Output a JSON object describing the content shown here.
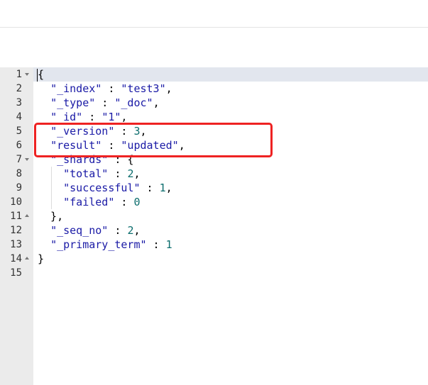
{
  "gutter": {
    "line_numbers": [
      "1",
      "2",
      "3",
      "4",
      "5",
      "6",
      "7",
      "8",
      "9",
      "10",
      "11",
      "12",
      "13",
      "14",
      "15"
    ]
  },
  "code": {
    "lines": [
      [
        {
          "t": "{",
          "c": "punc"
        }
      ],
      [
        {
          "t": "  ",
          "c": "punc"
        },
        {
          "t": "\"_index\"",
          "c": "key"
        },
        {
          "t": " : ",
          "c": "punc"
        },
        {
          "t": "\"test3\"",
          "c": "str"
        },
        {
          "t": ",",
          "c": "punc"
        }
      ],
      [
        {
          "t": "  ",
          "c": "punc"
        },
        {
          "t": "\"_type\"",
          "c": "key"
        },
        {
          "t": " : ",
          "c": "punc"
        },
        {
          "t": "\"_doc\"",
          "c": "str"
        },
        {
          "t": ",",
          "c": "punc"
        }
      ],
      [
        {
          "t": "  ",
          "c": "punc"
        },
        {
          "t": "\"_id\"",
          "c": "key"
        },
        {
          "t": " : ",
          "c": "punc"
        },
        {
          "t": "\"1\"",
          "c": "str"
        },
        {
          "t": ",",
          "c": "punc"
        }
      ],
      [
        {
          "t": "  ",
          "c": "punc"
        },
        {
          "t": "\"_version\"",
          "c": "key"
        },
        {
          "t": " : ",
          "c": "punc"
        },
        {
          "t": "3",
          "c": "num"
        },
        {
          "t": ",",
          "c": "punc"
        }
      ],
      [
        {
          "t": "  ",
          "c": "punc"
        },
        {
          "t": "\"result\"",
          "c": "key"
        },
        {
          "t": " : ",
          "c": "punc"
        },
        {
          "t": "\"updated\"",
          "c": "str"
        },
        {
          "t": ",",
          "c": "punc"
        }
      ],
      [
        {
          "t": "  ",
          "c": "punc"
        },
        {
          "t": "\"_shards\"",
          "c": "key"
        },
        {
          "t": " : {",
          "c": "punc"
        }
      ],
      [
        {
          "t": "    ",
          "c": "punc"
        },
        {
          "t": "\"total\"",
          "c": "key"
        },
        {
          "t": " : ",
          "c": "punc"
        },
        {
          "t": "2",
          "c": "num"
        },
        {
          "t": ",",
          "c": "punc"
        }
      ],
      [
        {
          "t": "    ",
          "c": "punc"
        },
        {
          "t": "\"successful\"",
          "c": "key"
        },
        {
          "t": " : ",
          "c": "punc"
        },
        {
          "t": "1",
          "c": "num"
        },
        {
          "t": ",",
          "c": "punc"
        }
      ],
      [
        {
          "t": "    ",
          "c": "punc"
        },
        {
          "t": "\"failed\"",
          "c": "key"
        },
        {
          "t": " : ",
          "c": "punc"
        },
        {
          "t": "0",
          "c": "num"
        }
      ],
      [
        {
          "t": "  },",
          "c": "punc"
        }
      ],
      [
        {
          "t": "  ",
          "c": "punc"
        },
        {
          "t": "\"_seq_no\"",
          "c": "key"
        },
        {
          "t": " : ",
          "c": "punc"
        },
        {
          "t": "2",
          "c": "num"
        },
        {
          "t": ",",
          "c": "punc"
        }
      ],
      [
        {
          "t": "  ",
          "c": "punc"
        },
        {
          "t": "\"_primary_term\"",
          "c": "key"
        },
        {
          "t": " : ",
          "c": "punc"
        },
        {
          "t": "1",
          "c": "num"
        }
      ],
      [
        {
          "t": "}",
          "c": "punc"
        }
      ],
      []
    ],
    "fold_markers": [
      "open",
      "",
      "",
      "",
      "",
      "",
      "open",
      "",
      "",
      "",
      "close",
      "",
      "",
      "close",
      ""
    ]
  },
  "colors": {
    "key": "#1a1aa6",
    "string": "#1a1aa6",
    "number": "#0b6d6d",
    "highlight_box": "#ee2222",
    "gutter_bg": "#ebebeb",
    "active_line_bg": "#e2e6ee"
  }
}
